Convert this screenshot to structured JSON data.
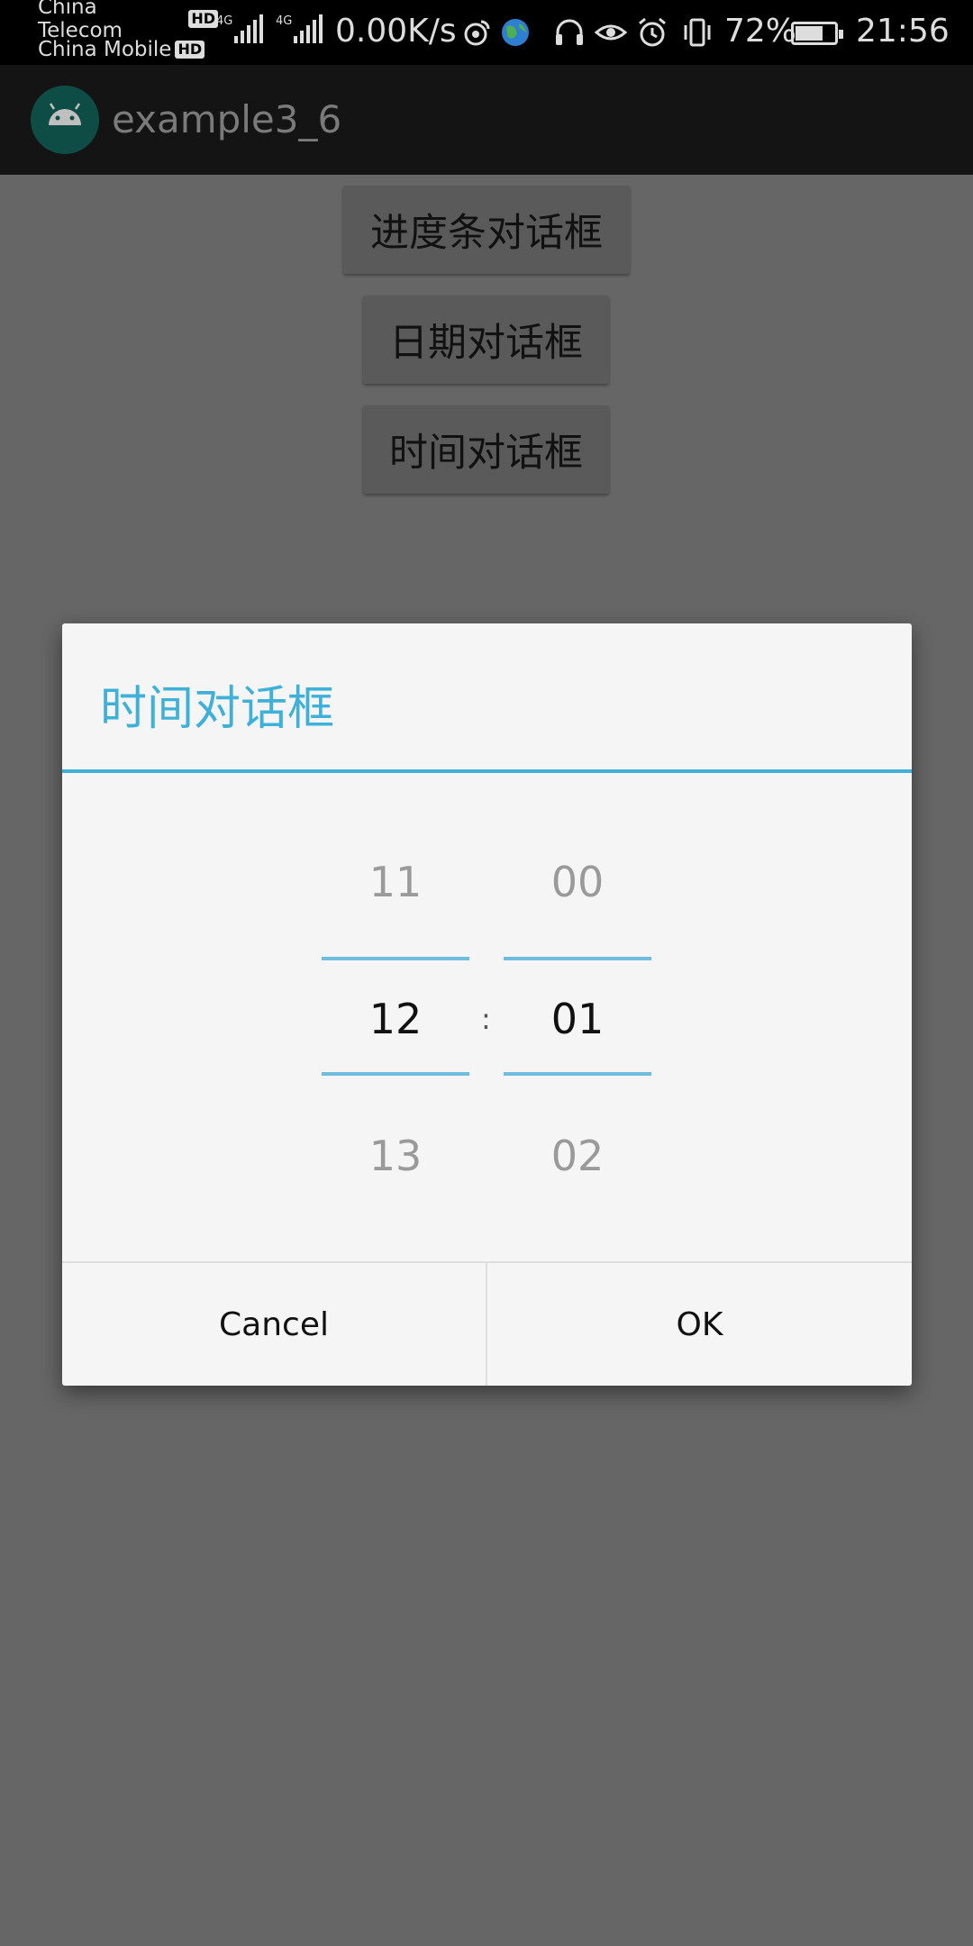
{
  "status_bar": {
    "carrier1": "China Telecom",
    "carrier2": "China Mobile",
    "hd_badge": "HD",
    "net_tag": "4G",
    "speed": "0.00K/s",
    "battery_percent": "72%",
    "battery_level": 0.72,
    "time": "21:56"
  },
  "app_bar": {
    "title": "example3_6",
    "icon": "android-icon"
  },
  "main": {
    "buttons": [
      "进度条对话框",
      "日期对话框",
      "时间对话框"
    ]
  },
  "dialog": {
    "title": "时间对话框",
    "hour": {
      "prev": "11",
      "current": "12",
      "next": "13"
    },
    "minute": {
      "prev": "00",
      "current": "01",
      "next": "02"
    },
    "separator": ":",
    "cancel_label": "Cancel",
    "ok_label": "OK"
  },
  "colors": {
    "accent": "#3fb1d9",
    "dialog_bg": "#f5f5f5",
    "scrim": "#666666"
  }
}
